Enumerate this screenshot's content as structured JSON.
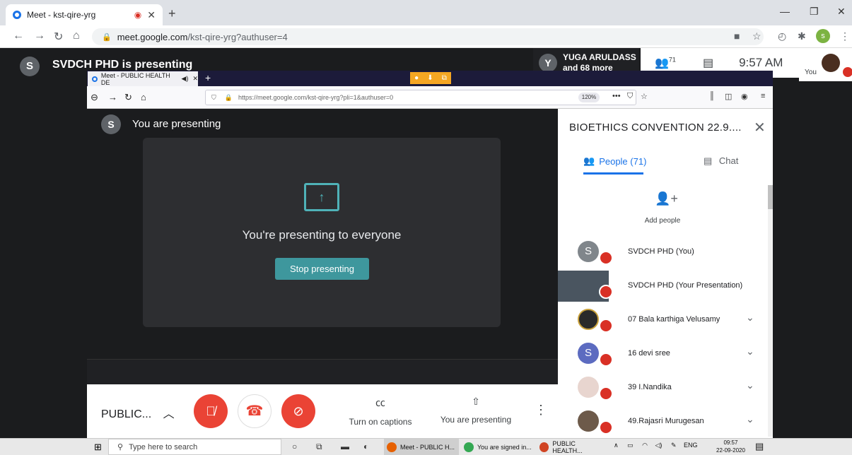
{
  "browser": {
    "tab_title": "Meet - kst-qire-yrg",
    "url_host": "meet.google.com",
    "url_path": "/kst-qire-yrg?authuser=4",
    "profile_letter": "s"
  },
  "meet_header": {
    "presenter_avatar_letter": "S",
    "presenter_label": "SVDCH PHD is presenting",
    "tile_avatar_letter": "Y",
    "tile_name": "YUGA ARULDASS",
    "tile_more": "and 68 more",
    "participant_count": "71",
    "clock": "9:57 AM",
    "self_label": "You"
  },
  "inner_browser": {
    "tab_title": "Meet - PUBLIC HEALTH DE",
    "url": "https://meet.google.com/kst-qire-yrg?pli=1&authuser=0",
    "zoom": "120%"
  },
  "presentation": {
    "avatar_letter": "S",
    "you_are_presenting": "You are presenting",
    "presenting_to_everyone": "You're presenting to everyone",
    "stop_button": "Stop presenting"
  },
  "bottom_bar": {
    "meeting_name": "PUBLIC...",
    "captions_label": "Turn on captions",
    "presenting_label": "You are presenting"
  },
  "panel": {
    "title": "BIOETHICS CONVENTION 22.9....",
    "people_tab": "People (71)",
    "chat_tab": "Chat",
    "add_people": "Add people",
    "participants": [
      {
        "name": "SVDCH PHD (You)",
        "avatar": "S",
        "color": "#80868b",
        "chevron": false
      },
      {
        "name": "SVDCH PHD (Your Presentation)",
        "avatar": "",
        "color": "#4a5560",
        "chevron": false
      },
      {
        "name": "07 Bala karthiga Velusamy",
        "avatar": "",
        "color": "#2a2a2a",
        "chevron": true
      },
      {
        "name": "16 devi sree",
        "avatar": "S",
        "color": "#5c6bc0",
        "chevron": true
      },
      {
        "name": "39 I.Nandika",
        "avatar": "",
        "color": "#e8d5cf",
        "chevron": true
      },
      {
        "name": "49.Rajasri Murugesan",
        "avatar": "",
        "color": "#6d5a4a",
        "chevron": true
      }
    ]
  },
  "taskbar": {
    "search_placeholder": "Type here to search",
    "apps": [
      "Meet - PUBLIC H...",
      "You are signed in...",
      "PUBLIC HEALTH..."
    ],
    "lang": "ENG",
    "time": "09:57",
    "date": "22-09-2020"
  }
}
